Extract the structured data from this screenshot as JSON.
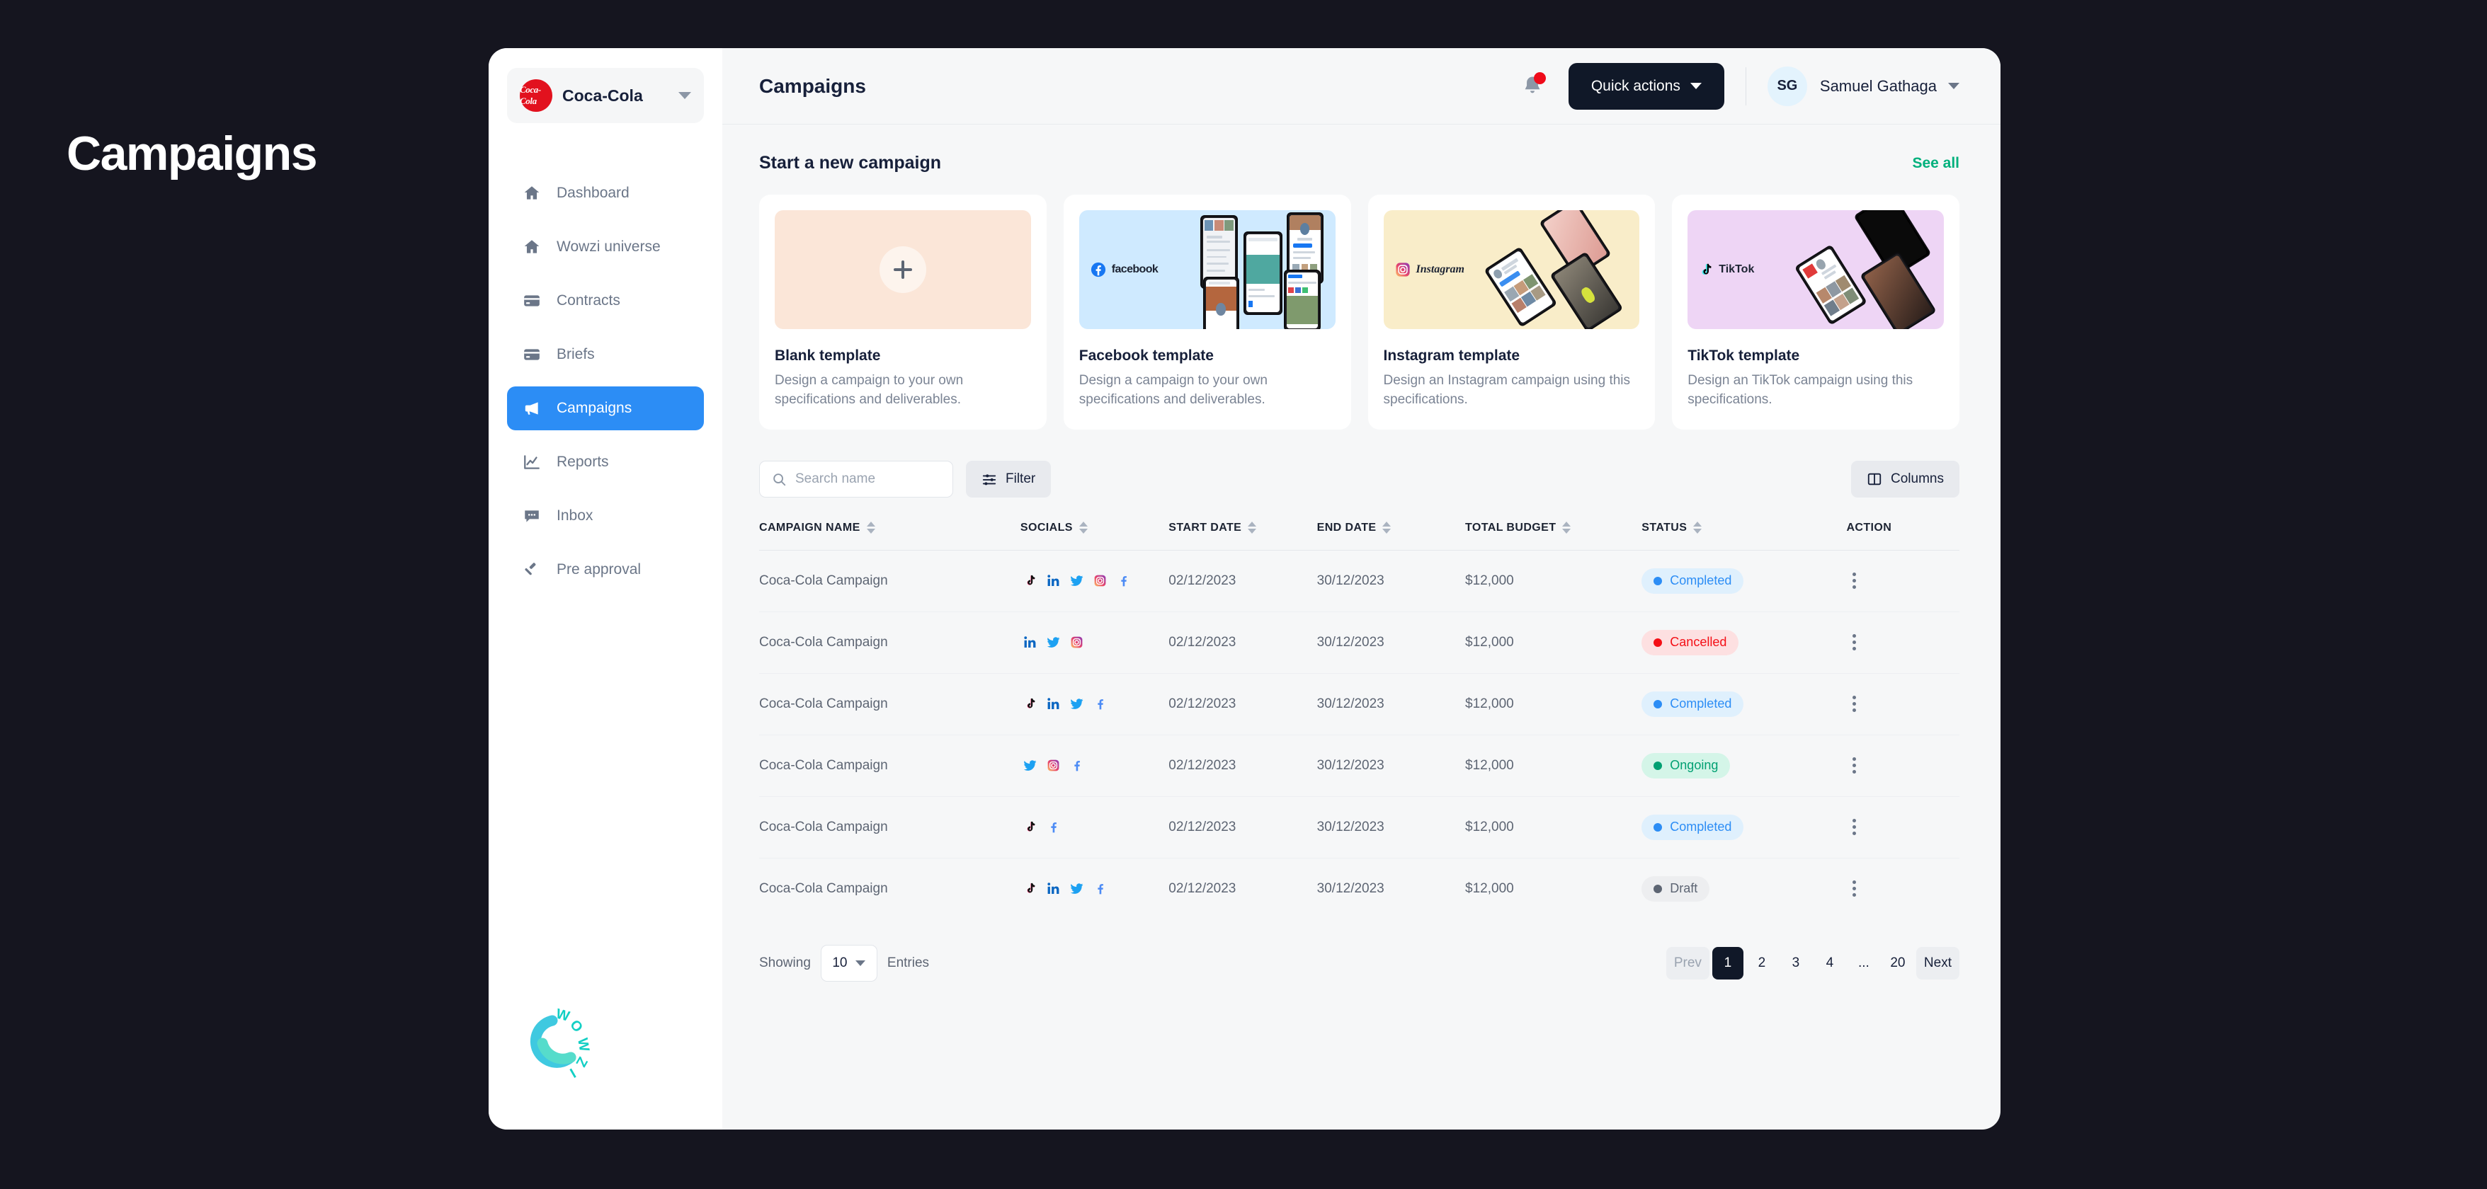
{
  "hero": {
    "title": "Campaigns"
  },
  "sidebar": {
    "brand": {
      "name": "Coca-Cola",
      "logo_text": "Coca-Cola",
      "logo_color": "#e2111e"
    },
    "items": [
      {
        "label": "Dashboard",
        "icon": "home-icon",
        "active": false
      },
      {
        "label": "Wowzi universe",
        "icon": "home-icon",
        "active": false
      },
      {
        "label": "Contracts",
        "icon": "card-icon",
        "active": false
      },
      {
        "label": "Briefs",
        "icon": "card-icon",
        "active": false
      },
      {
        "label": "Campaigns",
        "icon": "megaphone-icon",
        "active": true
      },
      {
        "label": "Reports",
        "icon": "chart-line-icon",
        "active": false
      },
      {
        "label": "Inbox",
        "icon": "chat-icon",
        "active": false
      },
      {
        "label": "Pre approval",
        "icon": "gavel-icon",
        "active": false
      }
    ],
    "logo_name": "Wowzi"
  },
  "topbar": {
    "page_title": "Campaigns",
    "notification_badge": true,
    "quick_actions_label": "Quick actions",
    "user": {
      "initials": "SG",
      "name": "Samuel Gathaga"
    }
  },
  "templates_section": {
    "heading": "Start a new campaign",
    "see_all_label": "See all",
    "cards": [
      {
        "title": "Blank template",
        "desc": "Design a campaign to your own specifications and deliverables.",
        "thumb": "blank",
        "brand": "",
        "accent": "#fbe6d8"
      },
      {
        "title": "Facebook template",
        "desc": "Design a campaign to your own specifications and deliverables.",
        "thumb": "facebook",
        "brand": "facebook",
        "accent": "#cfeaff"
      },
      {
        "title": "Instagram template",
        "desc": "Design an Instagram campaign using this specifications.",
        "thumb": "instagram",
        "brand": "Instagram",
        "accent": "#f9edc9"
      },
      {
        "title": "TikTok template",
        "desc": "Design an TikTok campaign using this specifications.",
        "thumb": "tiktok",
        "brand": "TikTok",
        "accent": "#eed5f5"
      }
    ]
  },
  "toolbar": {
    "search_placeholder": "Search name",
    "search_value": "",
    "filter_label": "Filter",
    "columns_label": "Columns"
  },
  "table": {
    "columns": [
      {
        "label": "CAMPAIGN NAME",
        "sortable": true
      },
      {
        "label": "SOCIALS",
        "sortable": true
      },
      {
        "label": "START DATE",
        "sortable": true
      },
      {
        "label": "END DATE",
        "sortable": true
      },
      {
        "label": "TOTAL BUDGET",
        "sortable": true
      },
      {
        "label": "STATUS",
        "sortable": true
      },
      {
        "label": "ACTION",
        "sortable": false
      }
    ],
    "rows": [
      {
        "name": "Coca-Cola Campaign",
        "socials": [
          "tiktok",
          "linkedin",
          "twitter",
          "instagram",
          "facebook"
        ],
        "start": "02/12/2023",
        "end": "30/12/2023",
        "budget": "$12,000",
        "status": "Completed"
      },
      {
        "name": "Coca-Cola Campaign",
        "socials": [
          "linkedin",
          "twitter",
          "instagram"
        ],
        "start": "02/12/2023",
        "end": "30/12/2023",
        "budget": "$12,000",
        "status": "Cancelled"
      },
      {
        "name": "Coca-Cola Campaign",
        "socials": [
          "tiktok",
          "linkedin",
          "twitter",
          "facebook"
        ],
        "start": "02/12/2023",
        "end": "30/12/2023",
        "budget": "$12,000",
        "status": "Completed"
      },
      {
        "name": "Coca-Cola Campaign",
        "socials": [
          "twitter",
          "instagram",
          "facebook"
        ],
        "start": "02/12/2023",
        "end": "30/12/2023",
        "budget": "$12,000",
        "status": "Ongoing"
      },
      {
        "name": "Coca-Cola Campaign",
        "socials": [
          "tiktok",
          "facebook"
        ],
        "start": "02/12/2023",
        "end": "30/12/2023",
        "budget": "$12,000",
        "status": "Completed"
      },
      {
        "name": "Coca-Cola Campaign",
        "socials": [
          "tiktok",
          "linkedin",
          "twitter",
          "facebook"
        ],
        "start": "02/12/2023",
        "end": "30/12/2023",
        "budget": "$12,000",
        "status": "Draft"
      }
    ],
    "status_styles": {
      "Completed": {
        "color": "#2c8df5",
        "bg": "#dff0fd"
      },
      "Cancelled": {
        "color": "#f40f16",
        "bg": "#fde0e1"
      },
      "Ongoing": {
        "color": "#00a072",
        "bg": "#d4f5e8"
      },
      "Draft": {
        "color": "#5d6573",
        "bg": "#edeef0"
      }
    }
  },
  "pagination": {
    "showing_label": "Showing",
    "entries_value": "10",
    "entries_label": "Entries",
    "prev_label": "Prev",
    "next_label": "Next",
    "pages": [
      "1",
      "2",
      "3",
      "4",
      "...",
      "20"
    ],
    "current_page": "1"
  }
}
